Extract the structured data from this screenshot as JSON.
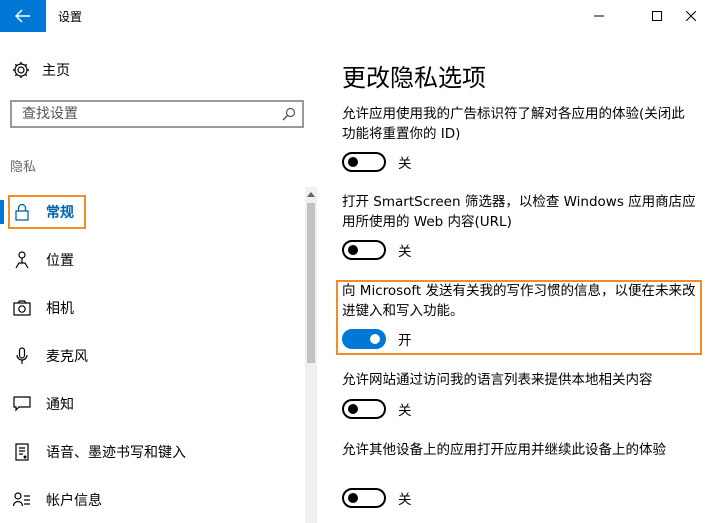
{
  "window": {
    "title": "设置"
  },
  "sidebar": {
    "home_label": "主页",
    "search_placeholder": "查找设置",
    "section_label": "隐私",
    "items": [
      {
        "label": "常规",
        "icon": "lock-icon",
        "active": true
      },
      {
        "label": "位置",
        "icon": "location-icon",
        "active": false
      },
      {
        "label": "相机",
        "icon": "camera-icon",
        "active": false
      },
      {
        "label": "麦克风",
        "icon": "microphone-icon",
        "active": false
      },
      {
        "label": "通知",
        "icon": "chat-bubble-icon",
        "active": false
      },
      {
        "label": "语音、墨迹书写和键入",
        "icon": "speech-document-icon",
        "active": false
      },
      {
        "label": "帐户信息",
        "icon": "account-info-icon",
        "active": false
      }
    ]
  },
  "main": {
    "title": "更改隐私选项",
    "options": [
      {
        "text": "允许应用使用我的广告标识符了解对各应用的体验(关闭此功能将重置你的 ID)",
        "state": "关",
        "on": false
      },
      {
        "text": "打开 SmartScreen 筛选器，以检查 Windows 应用商店应用所使用的 Web 内容(URL)",
        "state": "关",
        "on": false
      },
      {
        "text": "向 Microsoft 发送有关我的写作习惯的信息，以便在未来改进键入和写入功能。",
        "state": "开",
        "on": true
      },
      {
        "text": "允许网站通过访问我的语言列表来提供本地相关内容",
        "state": "关",
        "on": false
      },
      {
        "text": "允许其他设备上的应用打开应用并继续此设备上的体验",
        "state": "关",
        "on": false
      }
    ]
  },
  "colors": {
    "accent": "#0078d7",
    "highlight": "#f28c28"
  }
}
